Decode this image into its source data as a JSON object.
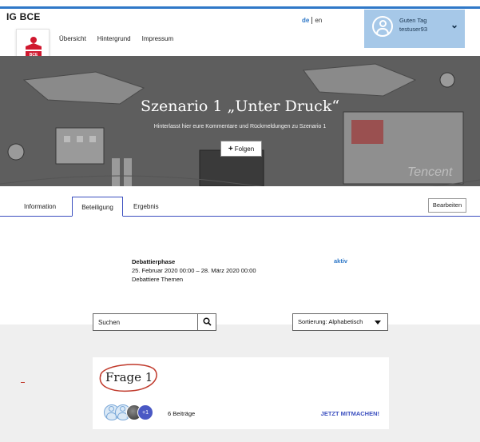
{
  "header": {
    "brand": "IG BCE",
    "nav": [
      "Übersicht",
      "Hintergrund",
      "Impressum"
    ],
    "lang": {
      "active": "de",
      "other": "en"
    },
    "user": {
      "greeting": "Guten Tag",
      "name": "testuser93"
    }
  },
  "hero": {
    "title": "Szenario 1 „Unter Druck“",
    "subtitle": "Hinterlasst hier eure Kommentare und Rückmeldungen zu Szenario 1",
    "follow_label": "Folgen"
  },
  "tabs": {
    "items": [
      "Information",
      "Beteiligung",
      "Ergebnis"
    ],
    "active": "Beteiligung",
    "edit_label": "Bearbeiten"
  },
  "phase": {
    "title": "Debattierphase",
    "dates": "25. Februar 2020 00:00 – 28. März 2020 00:00",
    "subtitle": "Debattiere Themen",
    "status": "aktiv"
  },
  "filters": {
    "search_placeholder": "Suchen",
    "sort_label": "Sortierung: Alphabetisch"
  },
  "topic": {
    "title": "Frage 1",
    "extra_count": "+1",
    "contributions": "6 Beiträge",
    "cta": "JETZT MITMACHEN!"
  },
  "colors": {
    "accent": "#2f78c8",
    "tab_border": "#3b4fbf",
    "user_box": "#a6c8e8",
    "logo_red": "#d0182f",
    "annotation": "#c0392b"
  }
}
